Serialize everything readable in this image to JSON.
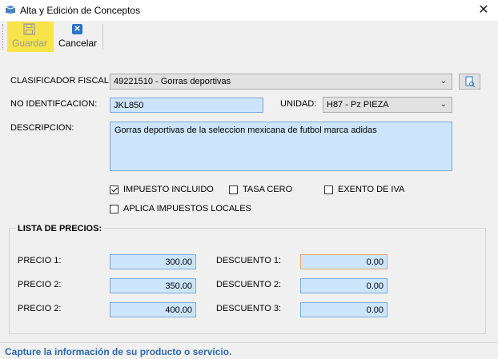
{
  "window": {
    "title": "Alta y Edición de Conceptos",
    "close_glyph": "✕"
  },
  "toolbar": {
    "save_label": "Guardar",
    "cancel_label": "Cancelar",
    "cancel_glyph": "✕"
  },
  "form": {
    "clasificador_label": "CLASIFICADOR FISCAL:",
    "clasificador_value": "49221510 - Gorras deportivas",
    "identificacion_label": "NO IDENTIFCACION:",
    "identificacion_value": "JKL850",
    "unidad_label": "UNIDAD:",
    "unidad_value": "H87 - Pz PIEZA",
    "descripcion_label": "DESCRIPCION:",
    "descripcion_value": "Gorras deportivas de la seleccion mexicana de futbol marca adidas",
    "checkboxes": {
      "impuesto_incluido": {
        "label": "IMPUESTO INCLUIDO",
        "checked": true
      },
      "tasa_cero": {
        "label": "TASA CERO",
        "checked": false
      },
      "exento_iva": {
        "label": "EXENTO DE IVA",
        "checked": false
      },
      "impuestos_locales": {
        "label": "APLICA IMPUESTOS LOCALES",
        "checked": false
      }
    }
  },
  "precios": {
    "title": "LISTA DE PRECIOS:",
    "rows": [
      {
        "precio_label": "PRECIO 1:",
        "precio_value": "300.00",
        "descuento_label": "DESCUENTO 1:",
        "descuento_value": "0.00"
      },
      {
        "precio_label": "PRECIO 2:",
        "precio_value": "350.00",
        "descuento_label": "DESCUENTO 2:",
        "descuento_value": "0.00"
      },
      {
        "precio_label": "PRECIO 2:",
        "precio_value": "400.00",
        "descuento_label": "DESCUENTO 3:",
        "descuento_value": "0.00"
      }
    ]
  },
  "status": {
    "text": "Capture la información de su producto o servicio."
  },
  "colors": {
    "accent": "#2d6ab3",
    "input_bg": "#cde5fb",
    "highlight": "#f6e44a"
  }
}
